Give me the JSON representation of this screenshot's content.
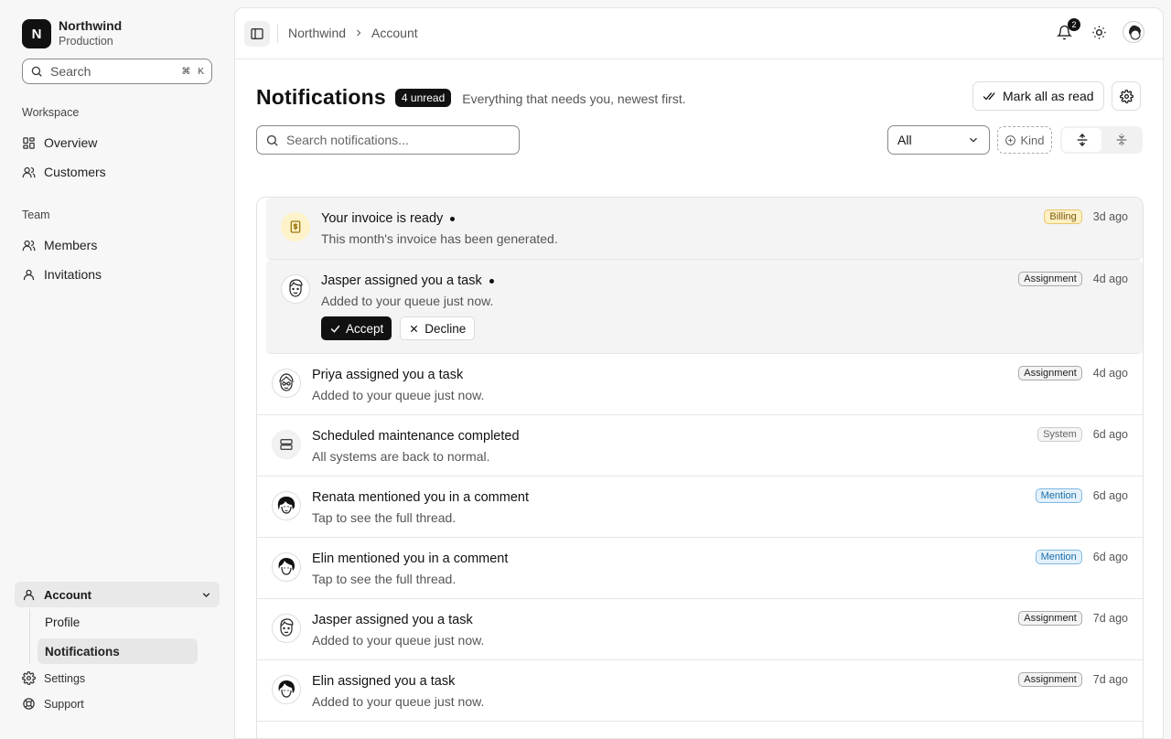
{
  "org": {
    "initial": "N",
    "name": "Northwind",
    "env": "Production"
  },
  "sidebar": {
    "search_placeholder": "Search",
    "shortcut_cmd": "⌘",
    "shortcut_key": "K",
    "workspace_label": "Workspace",
    "team_label": "Team",
    "items": {
      "overview": "Overview",
      "customers": "Customers",
      "members": "Members",
      "invitations": "Invitations"
    },
    "account": "Account",
    "profile": "Profile",
    "notifications": "Notifications",
    "settings": "Settings",
    "support": "Support"
  },
  "topbar": {
    "crumb_root": "Northwind",
    "crumb_current": "Account",
    "bell_count": "2"
  },
  "page": {
    "title": "Notifications",
    "unread_badge": "4 unread",
    "subtitle": "Everything that needs you, newest first.",
    "mark_all": "Mark all as read",
    "search_placeholder": "Search notifications...",
    "filter_value": "All",
    "kind_label": "Kind"
  },
  "notifications": [
    {
      "title": "Your invoice is ready",
      "subtitle": "This month's invoice has been generated.",
      "tag": "Billing",
      "ago": "3d ago"
    },
    {
      "title": "Jasper assigned you a task",
      "subtitle": "Added to your queue just now.",
      "tag": "Assignment",
      "ago": "4d ago",
      "accept": "Accept",
      "decline": "Decline"
    },
    {
      "title": "Priya assigned you a task",
      "subtitle": "Added to your queue just now.",
      "tag": "Assignment",
      "ago": "4d ago"
    },
    {
      "title": "Scheduled maintenance completed",
      "subtitle": "All systems are back to normal.",
      "tag": "System",
      "ago": "6d ago"
    },
    {
      "title": "Renata mentioned you in a comment",
      "subtitle": "Tap to see the full thread.",
      "tag": "Mention",
      "ago": "6d ago"
    },
    {
      "title": "Elin mentioned you in a comment",
      "subtitle": "Tap to see the full thread.",
      "tag": "Mention",
      "ago": "6d ago"
    },
    {
      "title": "Jasper assigned you a task",
      "subtitle": "Added to your queue just now.",
      "tag": "Assignment",
      "ago": "7d ago"
    },
    {
      "title": "Elin assigned you a task",
      "subtitle": "Added to your queue just now.",
      "tag": "Assignment",
      "ago": "7d ago"
    }
  ]
}
